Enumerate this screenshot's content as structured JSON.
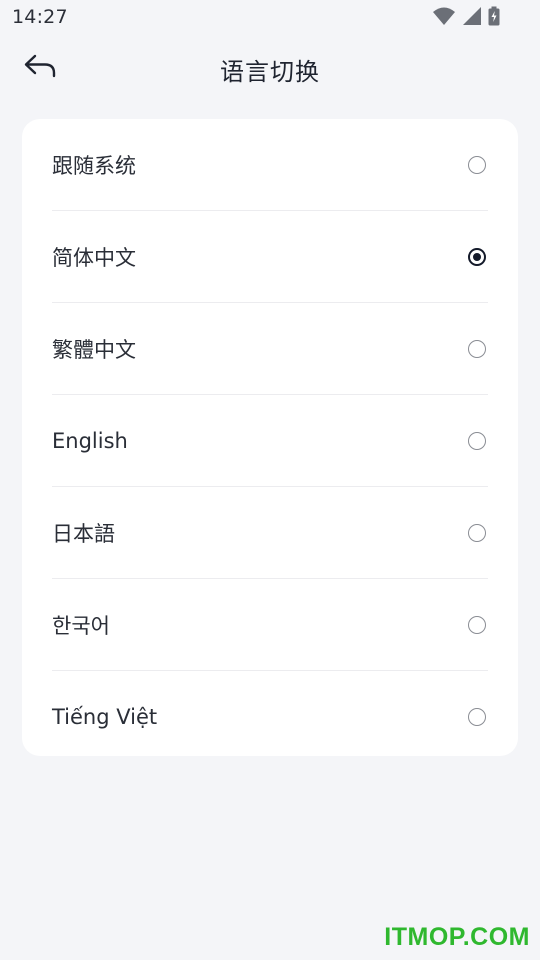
{
  "status_bar": {
    "time": "14:27",
    "icons": [
      "wifi-icon",
      "signal-icon",
      "battery-icon"
    ]
  },
  "header": {
    "back_icon": "back-arrow-icon",
    "title": "语言切换"
  },
  "languages": [
    {
      "label": "跟随系统",
      "selected": false
    },
    {
      "label": "简体中文",
      "selected": true
    },
    {
      "label": "繁體中文",
      "selected": false
    },
    {
      "label": "English",
      "selected": false
    },
    {
      "label": "日本語",
      "selected": false
    },
    {
      "label": "한국어",
      "selected": false
    },
    {
      "label": "Tiếng Việt",
      "selected": false
    }
  ],
  "colors": {
    "background": "#f4f5f8",
    "card": "#ffffff",
    "radio_selected": "#141a2a",
    "watermark": "#2fb82f"
  },
  "watermark": "ITMOP.COM"
}
